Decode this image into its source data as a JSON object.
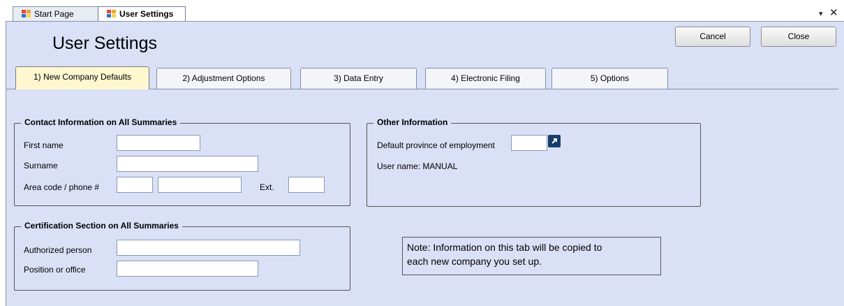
{
  "doc_tabs": [
    {
      "label": "Start Page"
    },
    {
      "label": "User Settings"
    }
  ],
  "window_controls": {
    "dropdown": "▾",
    "close": "✕"
  },
  "header": {
    "title": "User Settings",
    "cancel_label": "Cancel",
    "close_label": "Close"
  },
  "tabs": [
    {
      "label": "1) New Company Defaults"
    },
    {
      "label": "2) Adjustment Options"
    },
    {
      "label": "3) Data Entry"
    },
    {
      "label": "4) Electronic Filing"
    },
    {
      "label": "5) Options"
    }
  ],
  "contact": {
    "title": "Contact Information on All Summaries",
    "first_name_label": "First name",
    "first_name_value": "",
    "surname_label": "Surname",
    "surname_value": "",
    "phone_label": "Area code / phone #",
    "area_code_value": "",
    "phone_value": "",
    "ext_label": "Ext.",
    "ext_value": ""
  },
  "other": {
    "title": "Other Information",
    "province_label": "Default province of employment",
    "province_value": "",
    "username_text": "User name: MANUAL"
  },
  "certification": {
    "title": "Certification Section on All Summaries",
    "authorized_label": "Authorized person",
    "authorized_value": "",
    "position_label": "Position or office",
    "position_value": ""
  },
  "note": {
    "line1": "Note: Information on this tab will be copied to",
    "line2": "each new company you set up."
  }
}
